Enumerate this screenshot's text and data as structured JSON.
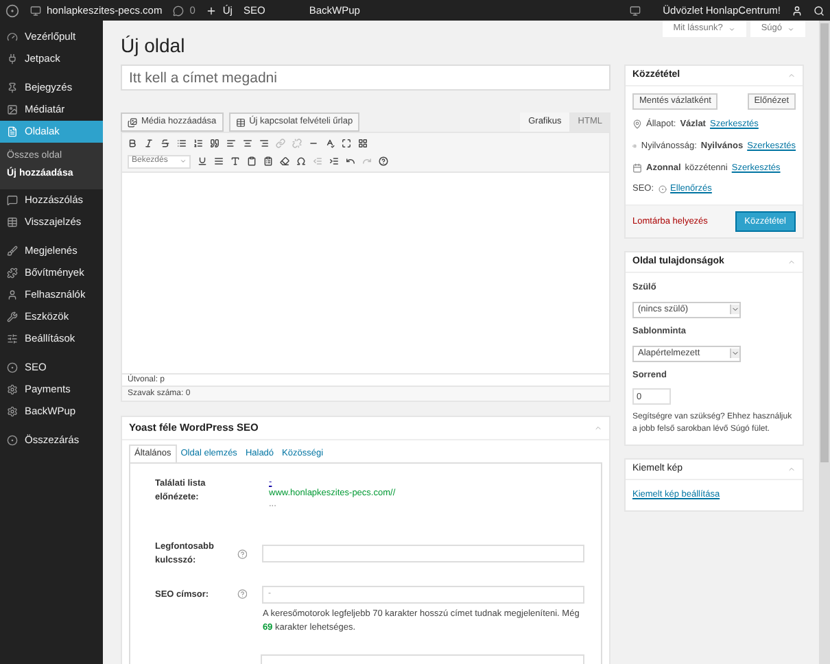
{
  "admin_bar": {
    "site": "honlapkeszites-pecs.com",
    "comments": "0",
    "new": "Új",
    "seo": "SEO",
    "backwpup": "BackWPup",
    "greeting": "Üdvözlet HonlapCentrum!"
  },
  "screen_tabs": [
    "Mit lássunk?",
    "Súgó"
  ],
  "sidebar": {
    "groups": [
      {
        "items": [
          {
            "label": "Vezérlőpult",
            "selected": false
          },
          {
            "label": "Jetpack",
            "selected": false
          }
        ]
      },
      {
        "items": [
          {
            "label": "Bejegyzés",
            "selected": false
          },
          {
            "label": "Médiatár",
            "selected": false
          },
          {
            "label": "Oldalak",
            "selected": true,
            "children": [
              {
                "label": "Összes oldal",
                "selected": false
              },
              {
                "label": "Új hozzáadása",
                "selected": true
              }
            ]
          },
          {
            "label": "Hozzászólás",
            "selected": false
          },
          {
            "label": "Visszajelzés",
            "selected": false
          }
        ]
      },
      {
        "items": [
          {
            "label": "Megjelenés",
            "selected": false
          },
          {
            "label": "Bővítmények",
            "selected": false
          },
          {
            "label": "Felhasználók",
            "selected": false
          },
          {
            "label": "Eszközök",
            "selected": false
          },
          {
            "label": "Beállítások",
            "selected": false
          }
        ]
      },
      {
        "items": [
          {
            "label": "SEO",
            "selected": false
          },
          {
            "label": "Payments",
            "selected": false
          },
          {
            "label": "BackWPup",
            "selected": false
          }
        ]
      },
      {
        "items": [
          {
            "label": "Összezárás",
            "selected": false
          }
        ]
      }
    ]
  },
  "page_title": "Új oldal",
  "editor": {
    "title_placeholder": "Itt kell a címet megadni",
    "media_buttons": [
      "Média hozzáadása",
      "Új kapcsolat felvételi űrlap"
    ],
    "tabs": [
      {
        "label": "Grafikus",
        "selected": true
      },
      {
        "label": "HTML",
        "selected": false
      }
    ],
    "format": "Bekezdés",
    "path": "Útvonal: p",
    "word_count": "Szavak száma: 0"
  },
  "seo_box": {
    "title": "Yoast féle WordPress SEO",
    "tabs": [
      {
        "label": "Általános",
        "selected": true
      },
      {
        "label": "Oldal elemzés",
        "selected": false
      },
      {
        "label": "Haladó",
        "selected": false
      },
      {
        "label": "Közösségi",
        "selected": false
      }
    ],
    "preview_label": "Találati lista előnézete:",
    "preview_link": "-",
    "preview_url": "www.honlapkeszites-pecs.com//",
    "preview_dots": "...",
    "keyword_label": "Legfontosabb kulcsszó:",
    "title_label": "SEO címsor:",
    "title_value": "-",
    "title_help": "A keresőmotorok legfeljebb 70 karakter hosszú címet tudnak megjeleníteni. Még **69** karakter lehetséges."
  },
  "publish": {
    "title": "Közzététel",
    "save_draft": "Mentés vázlatként",
    "preview": "Előnézet",
    "rows": [
      {
        "kind": "status",
        "label": "Állapot:",
        "value": "Vázlat",
        "link": "Szerkesztés"
      },
      {
        "kind": "visibility",
        "label": "Nyilvánosság:",
        "value": "Nyilvános",
        "link": "Szerkesztés"
      },
      {
        "kind": "schedule",
        "label": "közzétenni",
        "value": "Azonnal",
        "link": "Szerkesztés"
      },
      {
        "kind": "seo",
        "label": "SEO:",
        "link": "Ellenőrzés"
      }
    ],
    "trash": "Lomtárba helyezés",
    "publish": "Közzététel"
  },
  "page_attributes": {
    "title": "Oldal tulajdonságok",
    "parent_label": "Szülő",
    "parent": "(nincs szülő)",
    "template_label": "Sablonminta",
    "template": "Alapértelmezett",
    "order_label": "Sorrend",
    "order": "0",
    "help": "Segítségre van szükség? Ehhez használjuk a jobb felső sarokban lévő Súgó fület."
  },
  "featured_image": {
    "title": "Kiemelt kép",
    "link": "Kiemelt kép beállítása"
  }
}
